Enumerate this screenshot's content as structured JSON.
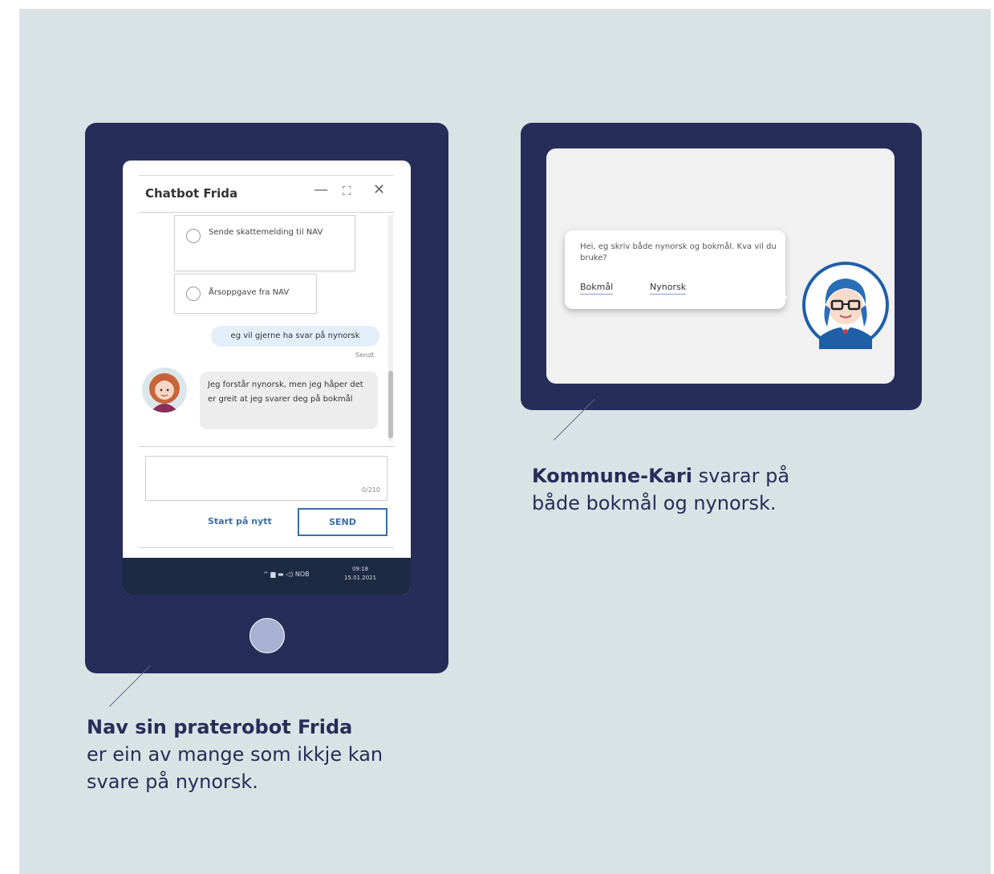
{
  "frida_widget": {
    "title": "Chatbot Frida",
    "controls": {
      "minimize": "—",
      "expand": "⛶",
      "close": "✕"
    },
    "options": [
      "Sende skattemelding til NAV",
      "Årsoppgave fra NAV"
    ],
    "user_message": "eg vil gjerne ha svar på nynorsk",
    "sent_label": "Sendt",
    "bot_message": "Jeg forstår nynorsk, men jeg håper det er greit at jeg svarer deg på bokmål",
    "char_counter": "0/210",
    "restart_label": "Start på nytt",
    "send_label": "SEND",
    "taskbar": {
      "tray": "^ ▆ ▬ ◁) NOB",
      "time": "09:18",
      "date": "15.01.2021"
    }
  },
  "kari_widget": {
    "message": "Hei, eg skriv både nynorsk og bokmål. Kva vil du bruke?",
    "options": [
      "Bokmål",
      "Nynorsk"
    ]
  },
  "captions": {
    "frida_title": "Nav sin praterobot Frida",
    "frida_body": "er ein av mange som ikkje kan svare på nynorsk.",
    "kari_title": "Kommune-Kari",
    "kari_body": "svarar på både bokmål og nynorsk."
  },
  "colors": {
    "background": "#d9e3e6",
    "device_frame": "#262d58",
    "home_button": "#a7b2d3",
    "link_blue": "#3b6ea8",
    "caption_text": "#262d58"
  }
}
